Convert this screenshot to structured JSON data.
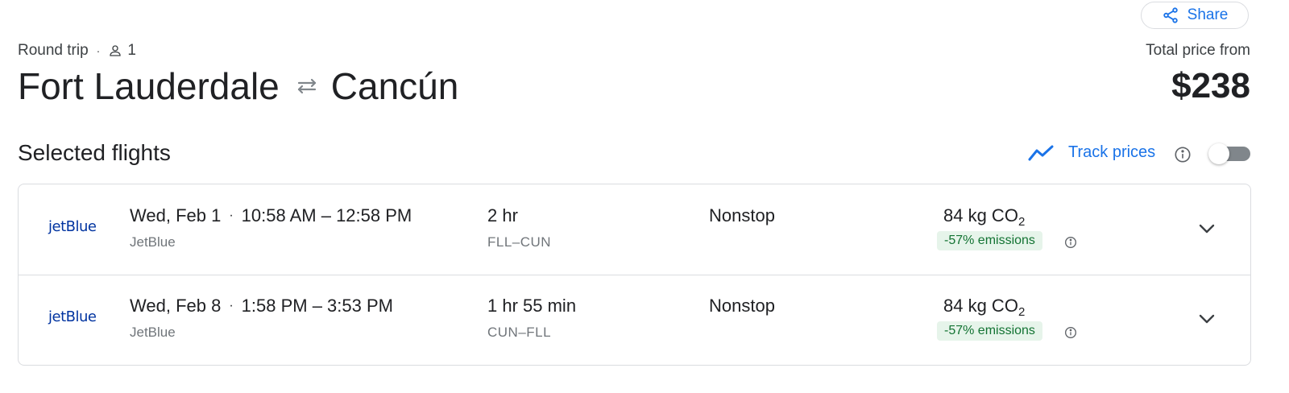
{
  "share": {
    "label": "Share",
    "icon": "share-icon"
  },
  "trip": {
    "type": "Round trip",
    "separator": "·",
    "passengers": "1",
    "origin": "Fort Lauderdale",
    "destination": "Cancún"
  },
  "price": {
    "label": "Total price from",
    "value": "$238"
  },
  "section": {
    "title": "Selected flights",
    "track_prices_label": "Track prices",
    "track_enabled": false
  },
  "flights": [
    {
      "airline_logo": "jetBlue",
      "date": "Wed, Feb 1",
      "times": "10:58 AM – 12:58 PM",
      "airline": "JetBlue",
      "duration": "2 hr",
      "route": "FLL–CUN",
      "stops": "Nonstop",
      "emissions_value": "84 kg CO",
      "emissions_sub": "2",
      "emissions_badge": "-57% emissions"
    },
    {
      "airline_logo": "jetBlue",
      "date": "Wed, Feb 8",
      "times": "1:58 PM – 3:53 PM",
      "airline": "JetBlue",
      "duration": "1 hr 55 min",
      "route": "CUN–FLL",
      "stops": "Nonstop",
      "emissions_value": "84 kg CO",
      "emissions_sub": "2",
      "emissions_badge": "-57% emissions"
    }
  ],
  "colors": {
    "accent": "#1a73e8",
    "text": "#202124",
    "secondary_text": "#70757a",
    "emissions_badge_bg": "#e6f4ea",
    "emissions_badge_text": "#137333",
    "jetblue_logo": "#0033a0",
    "border": "#dadce0"
  }
}
